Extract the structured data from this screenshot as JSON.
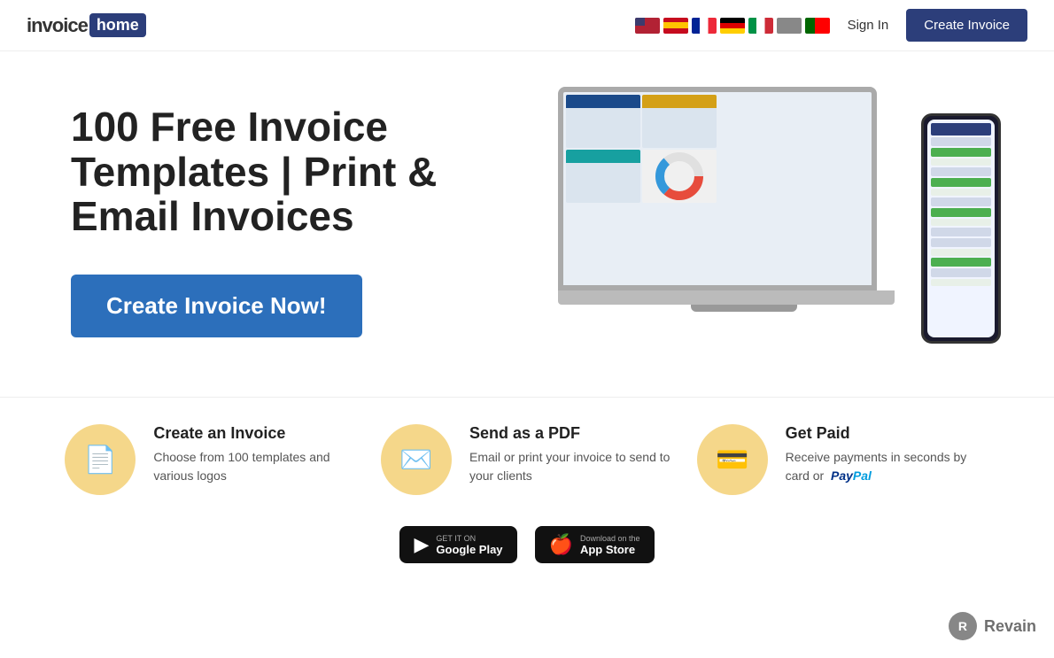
{
  "header": {
    "logo_invoice": "invoice",
    "logo_home": "home",
    "sign_in": "Sign In",
    "create_invoice_btn": "Create Invoice"
  },
  "flags": [
    {
      "code": "us",
      "label": "English"
    },
    {
      "code": "es",
      "label": "Spanish"
    },
    {
      "code": "fr",
      "label": "French"
    },
    {
      "code": "de",
      "label": "German"
    },
    {
      "code": "it",
      "label": "Italian"
    },
    {
      "code": "xx",
      "label": "Unknown"
    },
    {
      "code": "pt",
      "label": "Portuguese"
    }
  ],
  "hero": {
    "title": "100 Free Invoice Templates | Print & Email Invoices",
    "cta_button": "Create Invoice Now!"
  },
  "features": [
    {
      "icon": "📄",
      "title": "Create an Invoice",
      "description": "Choose from 100 templates and various logos"
    },
    {
      "icon": "✉️",
      "title": "Send as a PDF",
      "description": "Email or print your invoice to send to your clients"
    },
    {
      "icon": "💳",
      "title": "Get Paid",
      "description": "Receive payments in seconds by card or"
    }
  ],
  "paypal": "PayPal",
  "app_store": {
    "google_label_small": "GET IT ON",
    "google_label_big": "Google Play",
    "apple_label_small": "Download on the",
    "apple_label_big": "App Store"
  },
  "revain": {
    "label": "Revain"
  }
}
